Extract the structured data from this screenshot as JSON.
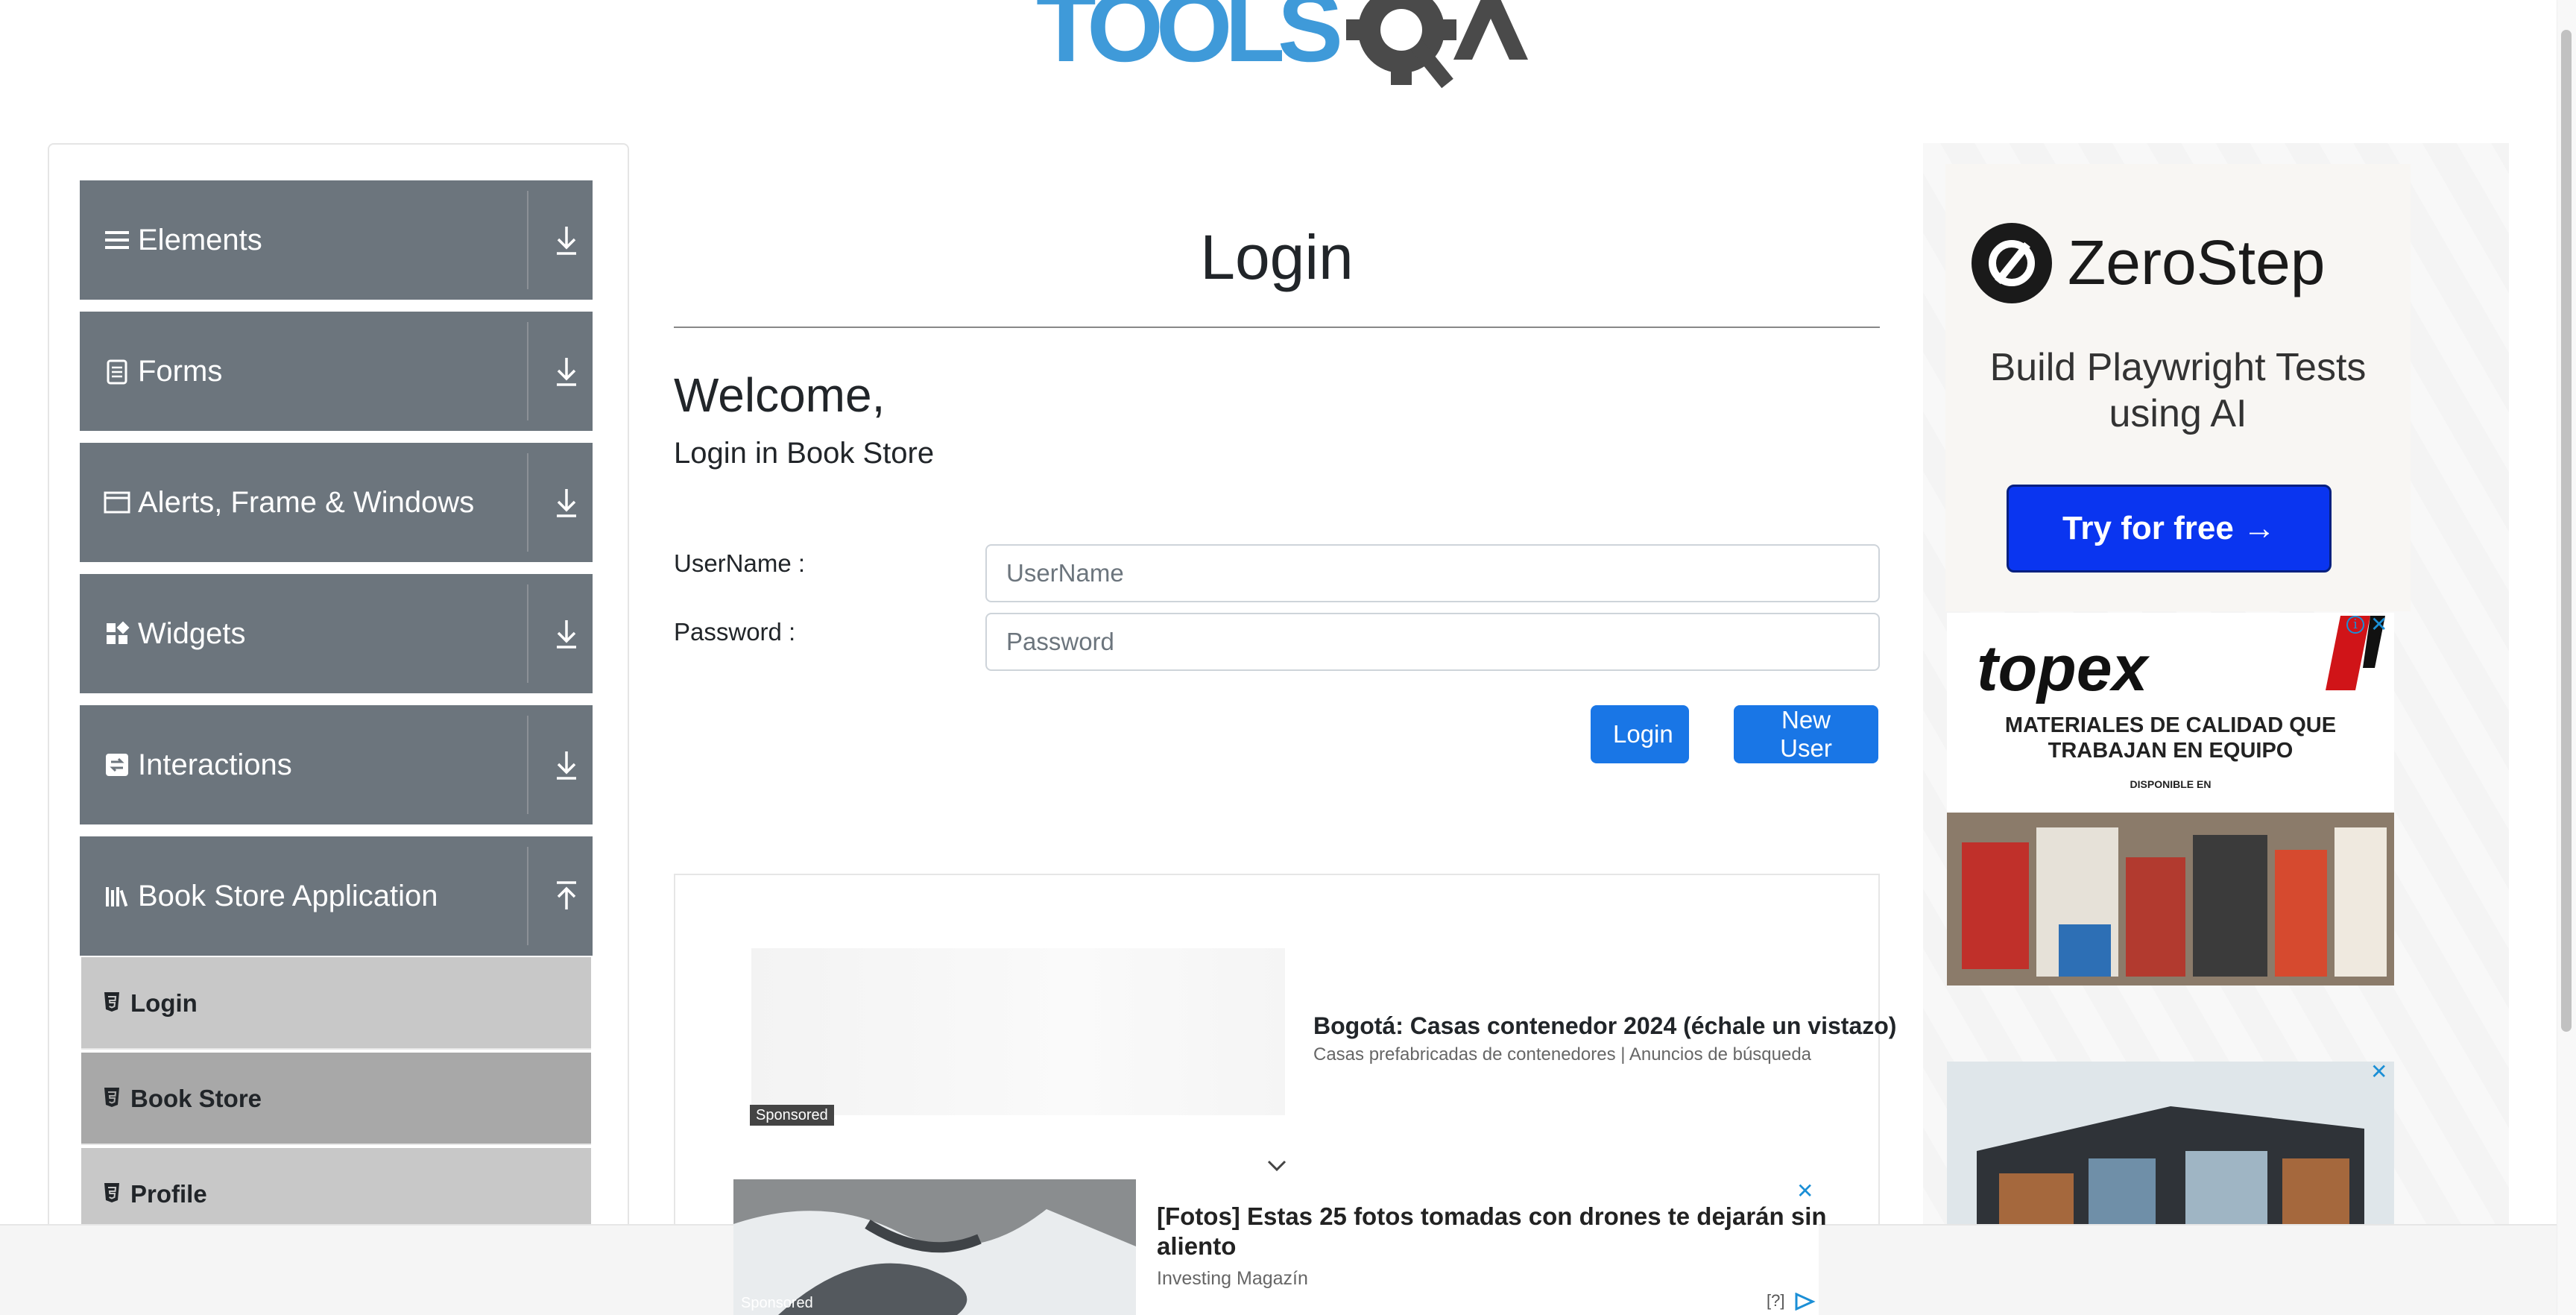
{
  "logo": {
    "text": "TOOLSQA"
  },
  "sidebar": {
    "groups": [
      {
        "label": "Elements",
        "icon": "hamburger-icon",
        "toggle": "download-icon"
      },
      {
        "label": "Forms",
        "icon": "form-icon",
        "toggle": "download-icon"
      },
      {
        "label": "Alerts, Frame & Windows",
        "icon": "window-icon",
        "toggle": "download-icon"
      },
      {
        "label": "Widgets",
        "icon": "widgets-icon",
        "toggle": "download-icon"
      },
      {
        "label": "Interactions",
        "icon": "interactions-icon",
        "toggle": "download-icon"
      },
      {
        "label": "Book Store Application",
        "icon": "books-icon",
        "toggle": "upload-icon"
      }
    ],
    "items": [
      {
        "label": "Login",
        "icon": "html5-icon"
      },
      {
        "label": "Book Store",
        "icon": "html5-icon"
      },
      {
        "label": "Profile",
        "icon": "html5-icon"
      }
    ]
  },
  "main": {
    "title": "Login",
    "welcome": "Welcome,",
    "subtitle": "Login in Book Store",
    "username_label": "UserName :",
    "username_placeholder": "UserName",
    "password_label": "Password :",
    "password_placeholder": "Password",
    "login_button": "Login",
    "new_user_button": "New User"
  },
  "ads": {
    "sponsored": "Sponsored",
    "inline_title": "Bogotá: Casas contenedor 2024 (échale un vistazo)",
    "inline_source": "Casas prefabricadas de contenedores | Anuncios de búsqueda",
    "zerostep_name": "ZeroStep",
    "zerostep_text": "Build Playwright Tests using AI",
    "zerostep_button": "Try for free →",
    "topex_logo": "topex",
    "topex_text": "MATERIALES DE CALIDAD QUE TRABAJAN EN EQUIPO",
    "topex_small": "DISPONIBLE EN",
    "banner_title": "[Fotos] Estas 25 fotos tomadas con drones te dejarán sin aliento",
    "banner_source": "Investing Magazín",
    "banner_help": "[?]",
    "close": "✕",
    "info": "i"
  },
  "colors": {
    "menu_bg": "#6c757d",
    "sub_bg": "#c8c8c8",
    "sub_active_bg": "#a8a8a8",
    "primary": "#1976e6",
    "logo_blue": "#3f9ad9",
    "logo_gray": "#4a4a4a"
  }
}
